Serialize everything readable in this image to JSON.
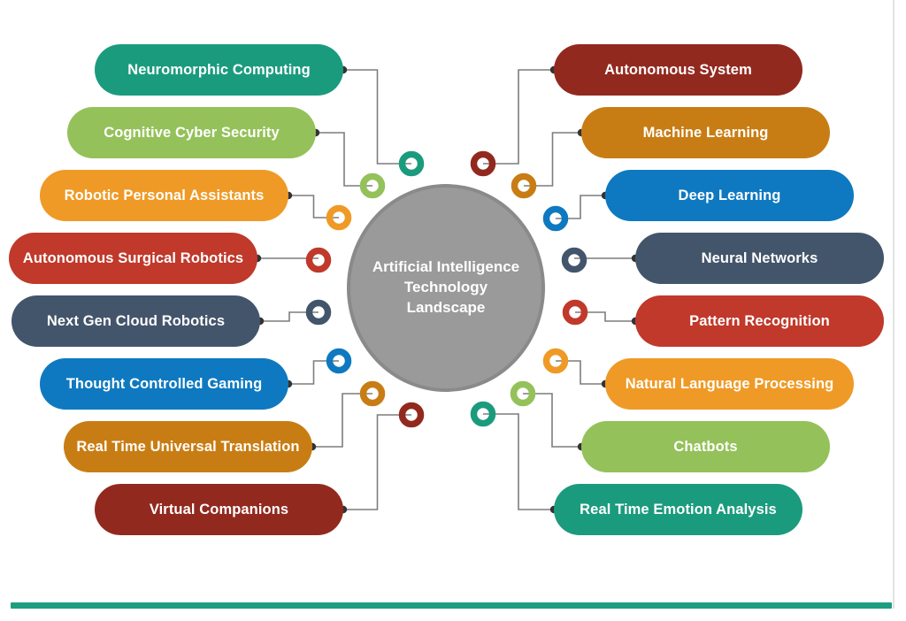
{
  "diagram": {
    "title": "Artificial Intelligence Technology Landscape",
    "hub": {
      "line1": "Artificial Intelligence",
      "line2": "Technology",
      "line3": "Landscape",
      "fill": "#9a9a9a",
      "stroke": "#8a8a8a"
    },
    "colors": {
      "teal": "#1b9b7e",
      "green": "#94c15a",
      "orange": "#ef9a26",
      "red": "#c0392b",
      "slate": "#43556b",
      "blue": "#0e79c0",
      "amber": "#c87d14",
      "darkred": "#92291f",
      "connector": "#7d7d7d",
      "dot": "#333333",
      "accent_bar": "#1c9e80"
    },
    "left_nodes": [
      {
        "label": "Neuromorphic Computing",
        "color": "#1b9b7e"
      },
      {
        "label": "Cognitive Cyber Security",
        "color": "#94c15a"
      },
      {
        "label": "Robotic Personal Assistants",
        "color": "#ef9a26"
      },
      {
        "label": "Autonomous Surgical Robotics",
        "color": "#c0392b"
      },
      {
        "label": "Next Gen Cloud Robotics",
        "color": "#43556b"
      },
      {
        "label": "Thought Controlled Gaming",
        "color": "#0e79c0"
      },
      {
        "label": "Real Time Universal Translation",
        "color": "#c87d14"
      },
      {
        "label": "Virtual Companions",
        "color": "#92291f"
      }
    ],
    "right_nodes": [
      {
        "label": "Autonomous System",
        "color": "#92291f"
      },
      {
        "label": "Machine Learning",
        "color": "#c87d14"
      },
      {
        "label": "Deep Learning",
        "color": "#0e79c0"
      },
      {
        "label": "Neural Networks",
        "color": "#43556b"
      },
      {
        "label": "Pattern Recognition",
        "color": "#c0392b"
      },
      {
        "label": "Natural Language Processing",
        "color": "#ef9a26"
      },
      {
        "label": "Chatbots",
        "color": "#94c15a"
      },
      {
        "label": "Real Time Emotion Analysis",
        "color": "#1b9b7e"
      }
    ]
  },
  "chart_data": {
    "type": "diagram",
    "layout": "radial-mind-map",
    "title": "Artificial Intelligence Technology Landscape",
    "center": "Artificial Intelligence Technology Landscape",
    "branch_count": 16,
    "branches": [
      {
        "label": "Neuromorphic Computing",
        "side": "left",
        "index": 0,
        "color": "#1b9b7e"
      },
      {
        "label": "Cognitive Cyber Security",
        "side": "left",
        "index": 1,
        "color": "#94c15a"
      },
      {
        "label": "Robotic Personal Assistants",
        "side": "left",
        "index": 2,
        "color": "#ef9a26"
      },
      {
        "label": "Autonomous Surgical Robotics",
        "side": "left",
        "index": 3,
        "color": "#c0392b"
      },
      {
        "label": "Next Gen Cloud Robotics",
        "side": "left",
        "index": 4,
        "color": "#43556b"
      },
      {
        "label": "Thought Controlled Gaming",
        "side": "left",
        "index": 5,
        "color": "#0e79c0"
      },
      {
        "label": "Real Time Universal Translation",
        "side": "left",
        "index": 6,
        "color": "#c87d14"
      },
      {
        "label": "Virtual Companions",
        "side": "left",
        "index": 7,
        "color": "#92291f"
      },
      {
        "label": "Autonomous System",
        "side": "right",
        "index": 0,
        "color": "#92291f"
      },
      {
        "label": "Machine Learning",
        "side": "right",
        "index": 1,
        "color": "#c87d14"
      },
      {
        "label": "Deep Learning",
        "side": "right",
        "index": 2,
        "color": "#0e79c0"
      },
      {
        "label": "Neural Networks",
        "side": "right",
        "index": 3,
        "color": "#43556b"
      },
      {
        "label": "Pattern Recognition",
        "side": "right",
        "index": 4,
        "color": "#c0392b"
      },
      {
        "label": "Natural Language Processing",
        "side": "right",
        "index": 5,
        "color": "#ef9a26"
      },
      {
        "label": "Chatbots",
        "side": "right",
        "index": 6,
        "color": "#94c15a"
      },
      {
        "label": "Real Time Emotion Analysis",
        "side": "right",
        "index": 7,
        "color": "#1b9b7e"
      }
    ]
  }
}
